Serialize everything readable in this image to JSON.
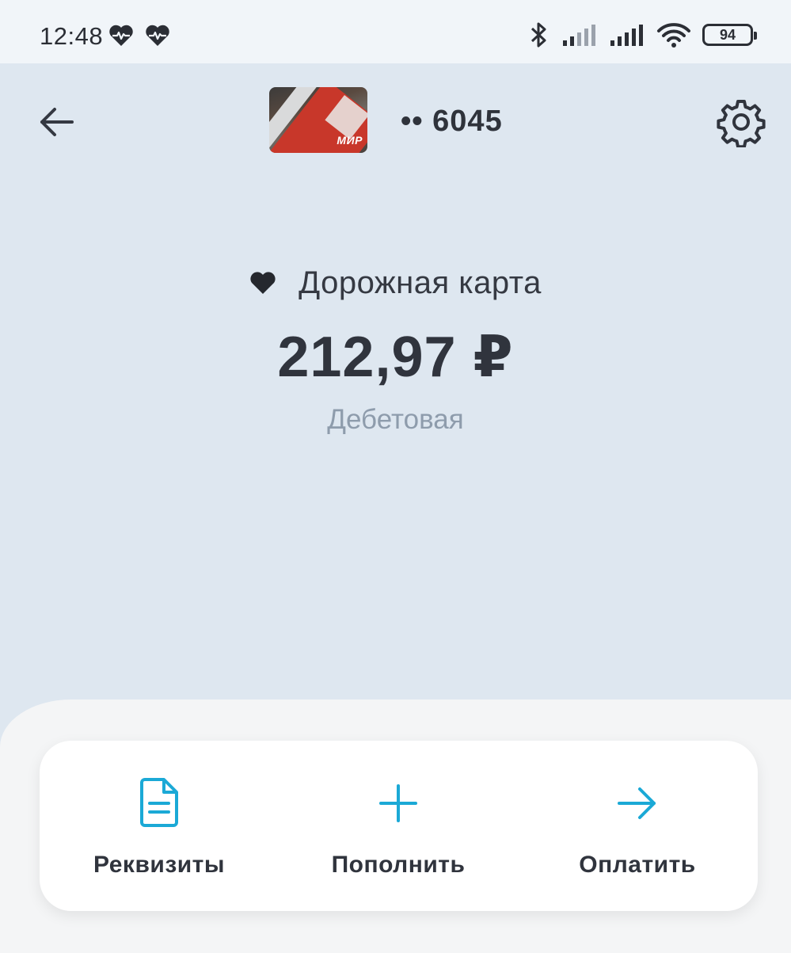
{
  "status_bar": {
    "time": "12:48",
    "battery": "94",
    "icons": [
      "heart-pulse-icon",
      "heart-pulse-icon",
      "bluetooth-icon",
      "signal-icon",
      "signal-icon",
      "wifi-icon",
      "battery-icon"
    ]
  },
  "header": {
    "back_icon": "arrow-left-icon",
    "settings_icon": "gear-icon",
    "card_logo": "МИР",
    "card_number": "•• 6045"
  },
  "account": {
    "favorite_icon": "heart-icon",
    "name": "Дорожная карта",
    "balance": "212,97 ₽",
    "type": "Дебетовая"
  },
  "actions": [
    {
      "label": "Реквизиты",
      "icon": "document-icon"
    },
    {
      "label": "Пополнить",
      "icon": "plus-icon"
    },
    {
      "label": "Оплатить",
      "icon": "arrow-right-icon"
    }
  ],
  "colors": {
    "background": "#dee7f0",
    "accent": "#1ba9d6",
    "text": "#30343d",
    "muted": "#8e9cac"
  }
}
